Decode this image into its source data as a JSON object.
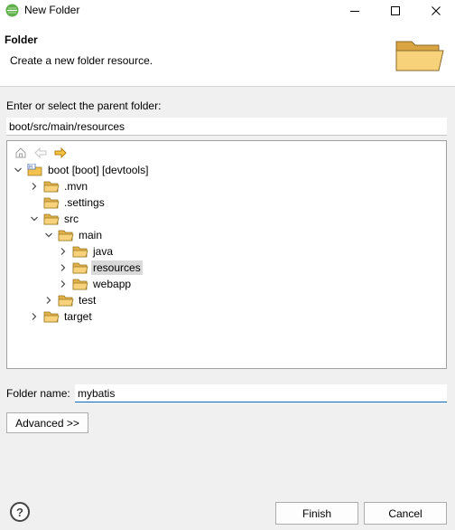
{
  "window": {
    "title": "New Folder"
  },
  "banner": {
    "title": "Folder",
    "description": "Create a new folder resource."
  },
  "parent_folder": {
    "label": "Enter or select the parent folder:",
    "value": "boot/src/main/resources"
  },
  "tree": {
    "toolbar": [
      "home-icon",
      "back-arrow-icon",
      "forward-arrow-icon"
    ],
    "items": [
      {
        "label": "boot [boot] [devtools]",
        "expanded": true,
        "icon": "project-icon"
      },
      {
        "label": ".mvn",
        "expanded": false,
        "icon": "folder-icon"
      },
      {
        "label": ".settings",
        "expanded": null,
        "icon": "folder-icon"
      },
      {
        "label": "src",
        "expanded": true,
        "icon": "folder-icon"
      },
      {
        "label": "main",
        "expanded": true,
        "icon": "folder-icon"
      },
      {
        "label": "java",
        "expanded": false,
        "icon": "folder-icon"
      },
      {
        "label": "resources",
        "expanded": false,
        "icon": "folder-icon",
        "selected": true
      },
      {
        "label": "webapp",
        "expanded": false,
        "icon": "folder-icon"
      },
      {
        "label": "test",
        "expanded": false,
        "icon": "folder-icon"
      },
      {
        "label": "target",
        "expanded": false,
        "icon": "folder-icon"
      }
    ]
  },
  "folder_name": {
    "label": "Folder name:",
    "value": "mybatis"
  },
  "buttons": {
    "advanced": "Advanced >>",
    "finish": "Finish",
    "cancel": "Cancel",
    "help": "?"
  },
  "colors": {
    "folder": "#f2c14e",
    "accent": "#0a6ac2",
    "selection": "#d9d9d9"
  }
}
